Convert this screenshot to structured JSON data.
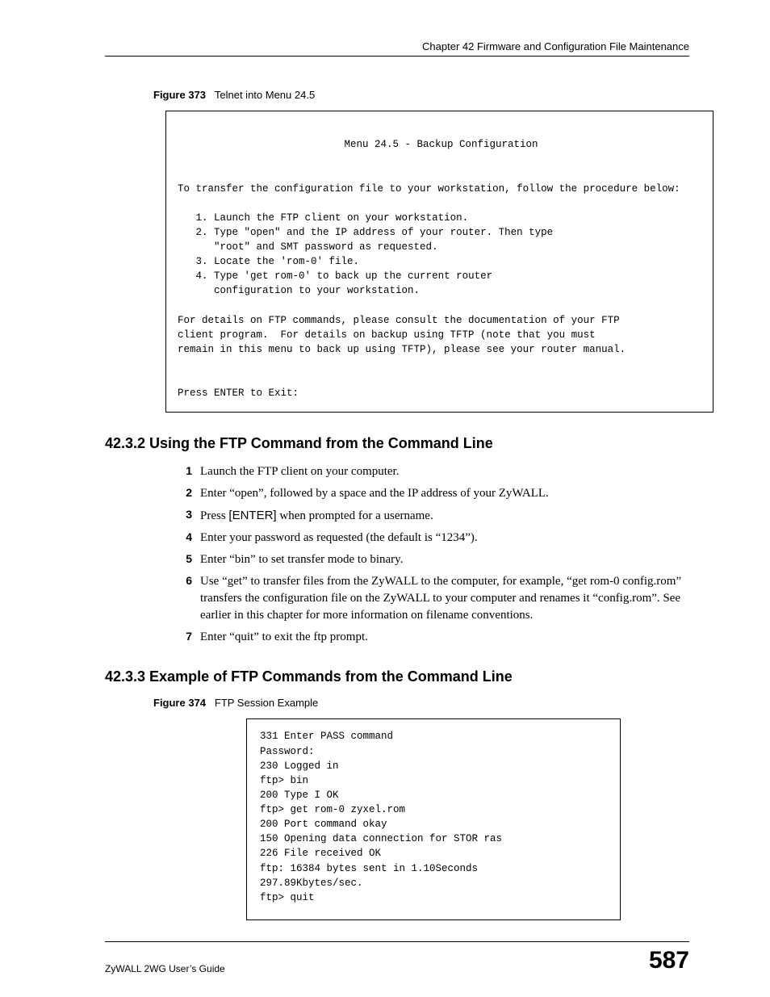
{
  "header": {
    "chapter": "Chapter 42 Firmware and Configuration File Maintenance"
  },
  "figure373": {
    "label": "Figure 373",
    "caption": "Telnet into Menu 24.5",
    "box": {
      "title": "Menu 24.5 - Backup Configuration",
      "intro": "To transfer the configuration file to your workstation, follow the procedure below:",
      "steps": {
        "s1": "1. Launch the FTP client on your workstation.",
        "s2a": "2. Type \"open\" and the IP address of your router. Then type",
        "s2b": "   \"root\" and SMT password as requested.",
        "s3": "3. Locate the 'rom-0' file.",
        "s4a": "4. Type 'get rom-0' to back up the current router",
        "s4b": "   configuration to your workstation.",
        "indent": "   "
      },
      "details1": "For details on FTP commands, please consult the documentation of your FTP",
      "details2": "client program.  For details on backup using TFTP (note that you must",
      "details3": "remain in this menu to back up using TFTP), please see your router manual.",
      "press": "Press ENTER to Exit:"
    }
  },
  "section4232": {
    "heading": "42.3.2  Using the FTP Command from the Command Line",
    "steps": {
      "s1": "Launch the FTP client on your computer.",
      "s2": "Enter “open”, followed by a space and the IP address of your ZyWALL.",
      "s3a": "Press ",
      "s3b": "[ENTER]",
      "s3c": " when prompted for a username.",
      "s4": "Enter your password as requested (the default is “1234”).",
      "s5": "Enter “bin” to set transfer mode to binary.",
      "s6": "Use “get” to transfer files from the ZyWALL to the computer, for example, “get rom-0 config.rom” transfers the configuration file on the ZyWALL to your computer and renames it “config.rom”. See earlier in this chapter for more information on filename conventions.",
      "s7": "Enter “quit” to exit the ftp prompt."
    }
  },
  "section4233": {
    "heading": "42.3.3  Example of FTP Commands from the Command Line"
  },
  "figure374": {
    "label": "Figure 374",
    "caption": "FTP Session Example",
    "lines": {
      "l1": "331 Enter PASS command",
      "l2": "Password:",
      "l3": "230 Logged in",
      "l4": "ftp> bin",
      "l5": "200 Type I OK",
      "l6": "ftp> get rom-0 zyxel.rom",
      "l7": "200 Port command okay",
      "l8": "150 Opening data connection for STOR ras",
      "l9": "226 File received OK",
      "l10": "ftp: 16384 bytes sent in 1.10Seconds",
      "l11": "297.89Kbytes/sec.",
      "l12": "ftp> quit"
    }
  },
  "footer": {
    "guide": "ZyWALL 2WG User’s Guide",
    "page": "587"
  }
}
